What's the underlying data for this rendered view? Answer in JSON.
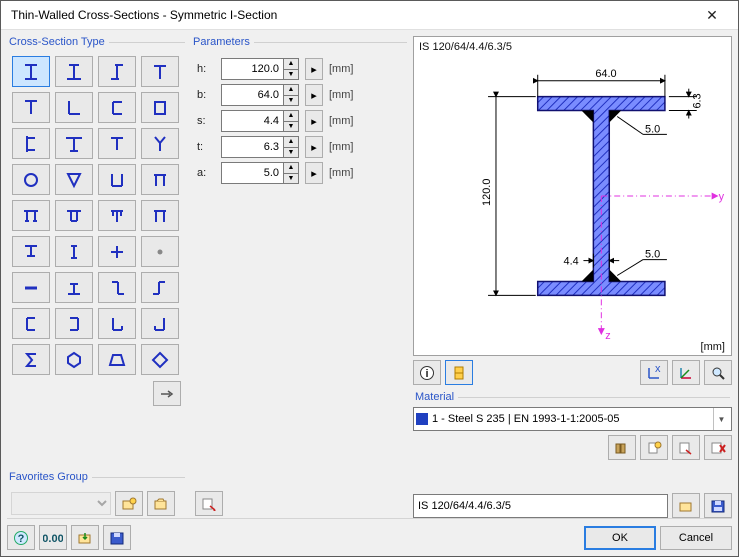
{
  "window": {
    "title": "Thin-Walled Cross-Sections - Symmetric I-Section"
  },
  "groups": {
    "cross_section_type": "Cross-Section Type",
    "parameters": "Parameters",
    "favorites": "Favorites Group",
    "material": "Material"
  },
  "type_grid": {
    "selected_index": 0,
    "items": [
      "i-symmetric",
      "i-section",
      "i-half",
      "tee",
      "tee-inv",
      "angle",
      "channel",
      "rect-tube",
      "c-section",
      "tee-wide",
      "tee-top",
      "y-section",
      "circle",
      "triangle-down",
      "u-section",
      "pi-section",
      "pi-top",
      "pi-closed",
      "pi-mid",
      "pi-right",
      "t-bottom",
      "i-narrow",
      "plus",
      "dot",
      "minus",
      "i-short",
      "z-section",
      "l-mirror",
      "c-open",
      "c-mirror",
      "l-section",
      "l-rev",
      "sigma",
      "hexagon",
      "trapezoid",
      "diamond"
    ]
  },
  "parameters": {
    "rows": [
      {
        "label": "h:",
        "value": "120.0",
        "unit": "[mm]"
      },
      {
        "label": "b:",
        "value": "64.0",
        "unit": "[mm]"
      },
      {
        "label": "s:",
        "value": "4.4",
        "unit": "[mm]"
      },
      {
        "label": "t:",
        "value": "6.3",
        "unit": "[mm]"
      },
      {
        "label": "a:",
        "value": "5.0",
        "unit": "[mm]"
      }
    ]
  },
  "preview": {
    "designation": "IS 120/64/4.4/6.3/5",
    "unit": "[mm]",
    "dims": {
      "h": "120.0",
      "b": "64.0",
      "s": "4.4",
      "t": "6.3",
      "a1": "5.0",
      "a2": "5.0"
    },
    "axes": {
      "y": "y",
      "z": "z"
    }
  },
  "preview_toolbar": {
    "items": [
      "info-btn",
      "stress-btn",
      "axis-btn",
      "local-axis-btn",
      "zoom-btn"
    ]
  },
  "material": {
    "selected": "1 - Steel S 235 | EN 1993-1-1:2005-05",
    "toolbar": [
      "mat-lib-btn",
      "mat-new-btn",
      "mat-edit-btn",
      "mat-del-btn"
    ]
  },
  "cross_section_name": {
    "value": "IS 120/64/4.4/6.3/5",
    "toolbar": [
      "cs-pick-btn",
      "cs-save-btn"
    ]
  },
  "footer": {
    "left_toolbar": [
      "help-btn",
      "units-btn",
      "import-btn",
      "export-btn"
    ],
    "ok": "OK",
    "cancel": "Cancel"
  }
}
